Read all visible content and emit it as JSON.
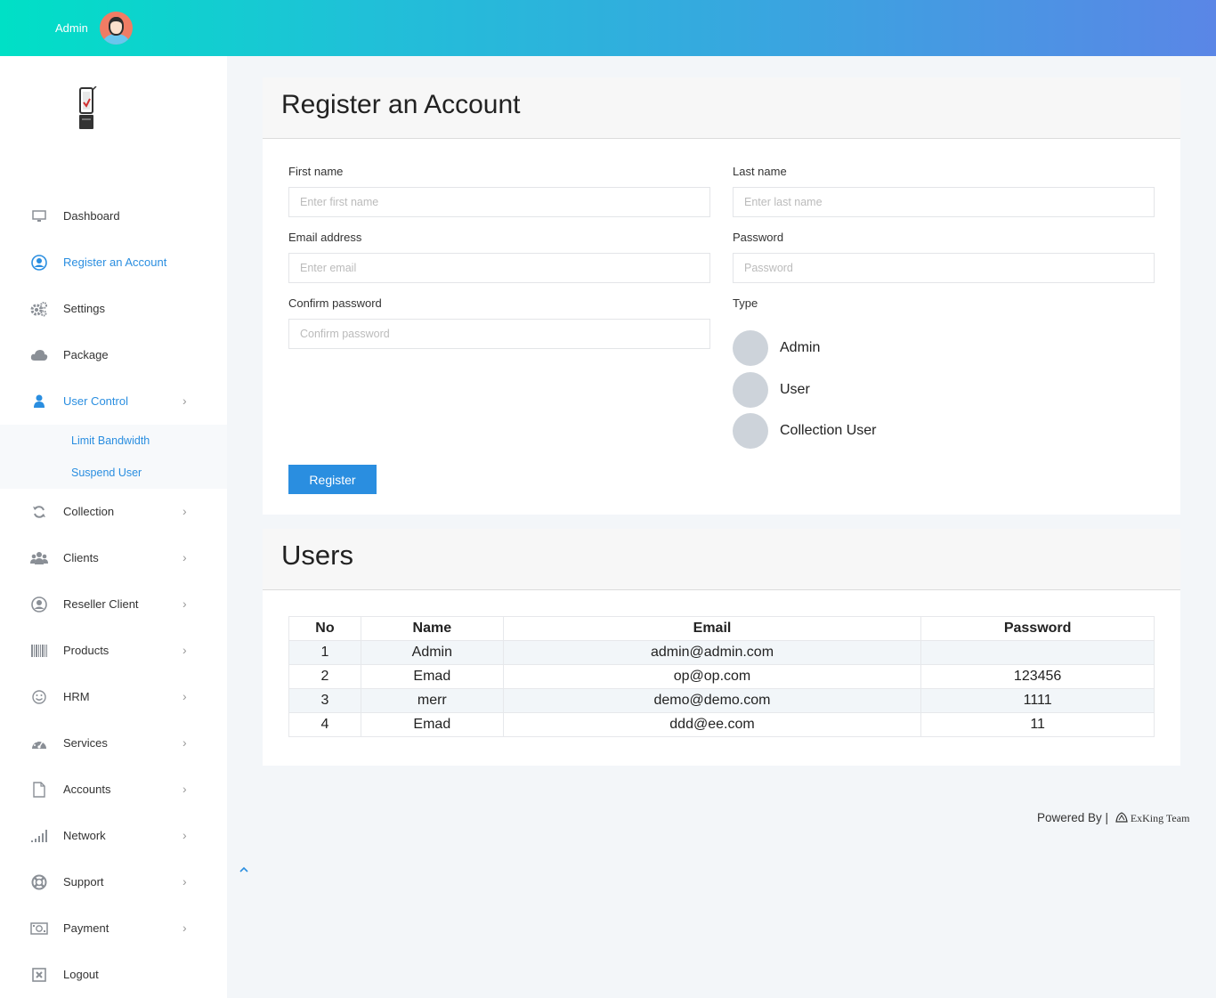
{
  "topbar": {
    "user_name": "Admin"
  },
  "sidebar": {
    "items": [
      {
        "label": "Dashboard",
        "icon": "monitor-icon"
      },
      {
        "label": "Register an Account",
        "icon": "user-circle-icon"
      },
      {
        "label": "Settings",
        "icon": "gears-icon"
      },
      {
        "label": "Package",
        "icon": "cloud-icon"
      },
      {
        "label": "User Control",
        "icon": "user-icon"
      },
      {
        "label": "Collection",
        "icon": "refresh-icon"
      },
      {
        "label": "Clients",
        "icon": "users-icon"
      },
      {
        "label": "Reseller Client",
        "icon": "user-circle-icon"
      },
      {
        "label": "Products",
        "icon": "barcode-icon"
      },
      {
        "label": "HRM",
        "icon": "smile-icon"
      },
      {
        "label": "Services",
        "icon": "dashboard-icon"
      },
      {
        "label": "Accounts",
        "icon": "file-icon"
      },
      {
        "label": "Network",
        "icon": "signal-icon"
      },
      {
        "label": "Support",
        "icon": "life-ring-icon"
      },
      {
        "label": "Payment",
        "icon": "money-icon"
      },
      {
        "label": "Logout",
        "icon": "close-box-icon"
      }
    ],
    "submenu": [
      "Limit Bandwidth",
      "Suspend User"
    ]
  },
  "register": {
    "title": "Register an Account",
    "first_name_label": "First name",
    "first_name_placeholder": "Enter first name",
    "last_name_label": "Last name",
    "last_name_placeholder": "Enter last name",
    "email_label": "Email address",
    "email_placeholder": "Enter email",
    "password_label": "Password",
    "password_placeholder": "Password",
    "confirm_label": "Confirm password",
    "confirm_placeholder": "Confirm password",
    "type_label": "Type",
    "types": [
      "Admin",
      "User",
      "Collection User"
    ],
    "button": "Register"
  },
  "users": {
    "title": "Users",
    "columns": [
      "No",
      "Name",
      "Email",
      "Password"
    ],
    "rows": [
      [
        "1",
        "Admin",
        "admin@admin.com",
        ""
      ],
      [
        "2",
        "Emad",
        "op@op.com",
        "123456"
      ],
      [
        "3",
        "merr",
        "demo@demo.com",
        "1111"
      ],
      [
        "4",
        "Emad",
        "ddd@ee.com",
        "11"
      ]
    ]
  },
  "footer": {
    "powered_by": "Powered By |",
    "brand": "ExKing Team"
  },
  "colors": {
    "accent": "#2a8ee0",
    "gradient_start": "#00e0c6",
    "gradient_end": "#5a86e6"
  }
}
